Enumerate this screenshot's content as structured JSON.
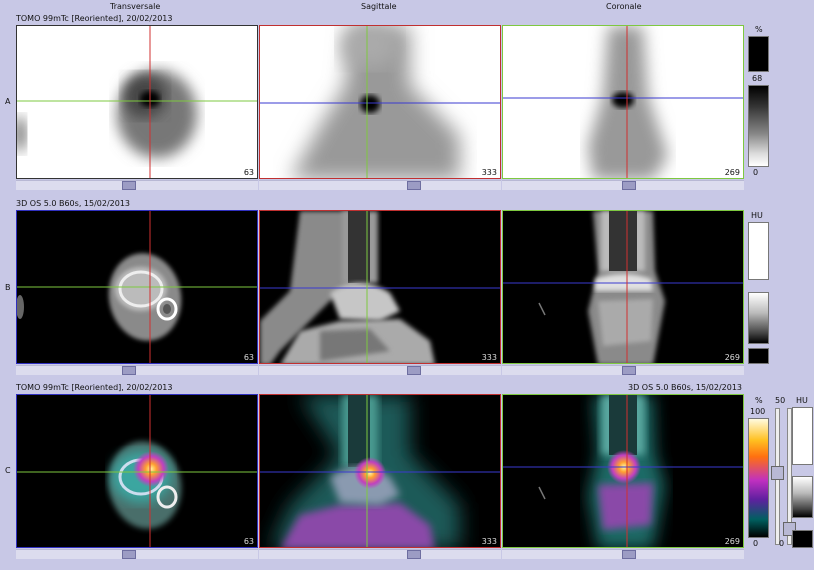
{
  "view_headers": [
    "Transversale",
    "Sagittale",
    "Coronale"
  ],
  "rows": [
    {
      "label": "A",
      "title": "TOMO 99mTc [Reoriented], 20/02/2013"
    },
    {
      "label": "B",
      "title": "3D  OS  5.0  B60s, 15/02/2013"
    },
    {
      "label": "C",
      "title": "TOMO 99mTc [Reoriented], 20/02/2013",
      "title_right": "3D  OS  5.0  B60s, 15/02/2013"
    }
  ],
  "slice_numbers": [
    "63",
    "333",
    "269"
  ],
  "scale_a": {
    "unit": "%",
    "max": "68",
    "min": "0"
  },
  "scale_b": {
    "unit": "HU"
  },
  "scale_c": {
    "unit": "%",
    "max": "100",
    "min": "0",
    "mid_label": "50",
    "ct_unit": "HU",
    "ct_min": "0"
  },
  "colors": {
    "crosshair_red": "#d03030",
    "crosshair_green": "#7ec840",
    "crosshair_blue": "#3a3ad0",
    "frame_blue": "#3030c0"
  }
}
